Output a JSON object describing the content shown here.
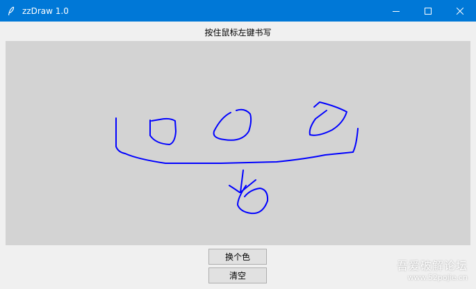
{
  "window": {
    "title": "zzDraw 1.0",
    "icon": "feather-icon",
    "titlebar_color": "#0078d7",
    "controls": {
      "minimize_icon": "minimize-icon",
      "maximize_icon": "maximize-icon",
      "close_icon": "close-icon"
    }
  },
  "instruction": "按住鼠标左键书写",
  "canvas": {
    "background": "#d3d3d3",
    "stroke_color": "#0000ff"
  },
  "buttons": {
    "change_color": "换个色",
    "clear": "清空"
  },
  "watermark": {
    "line1": "吾爱破解论坛",
    "line2": "www.52pojie.cn"
  }
}
